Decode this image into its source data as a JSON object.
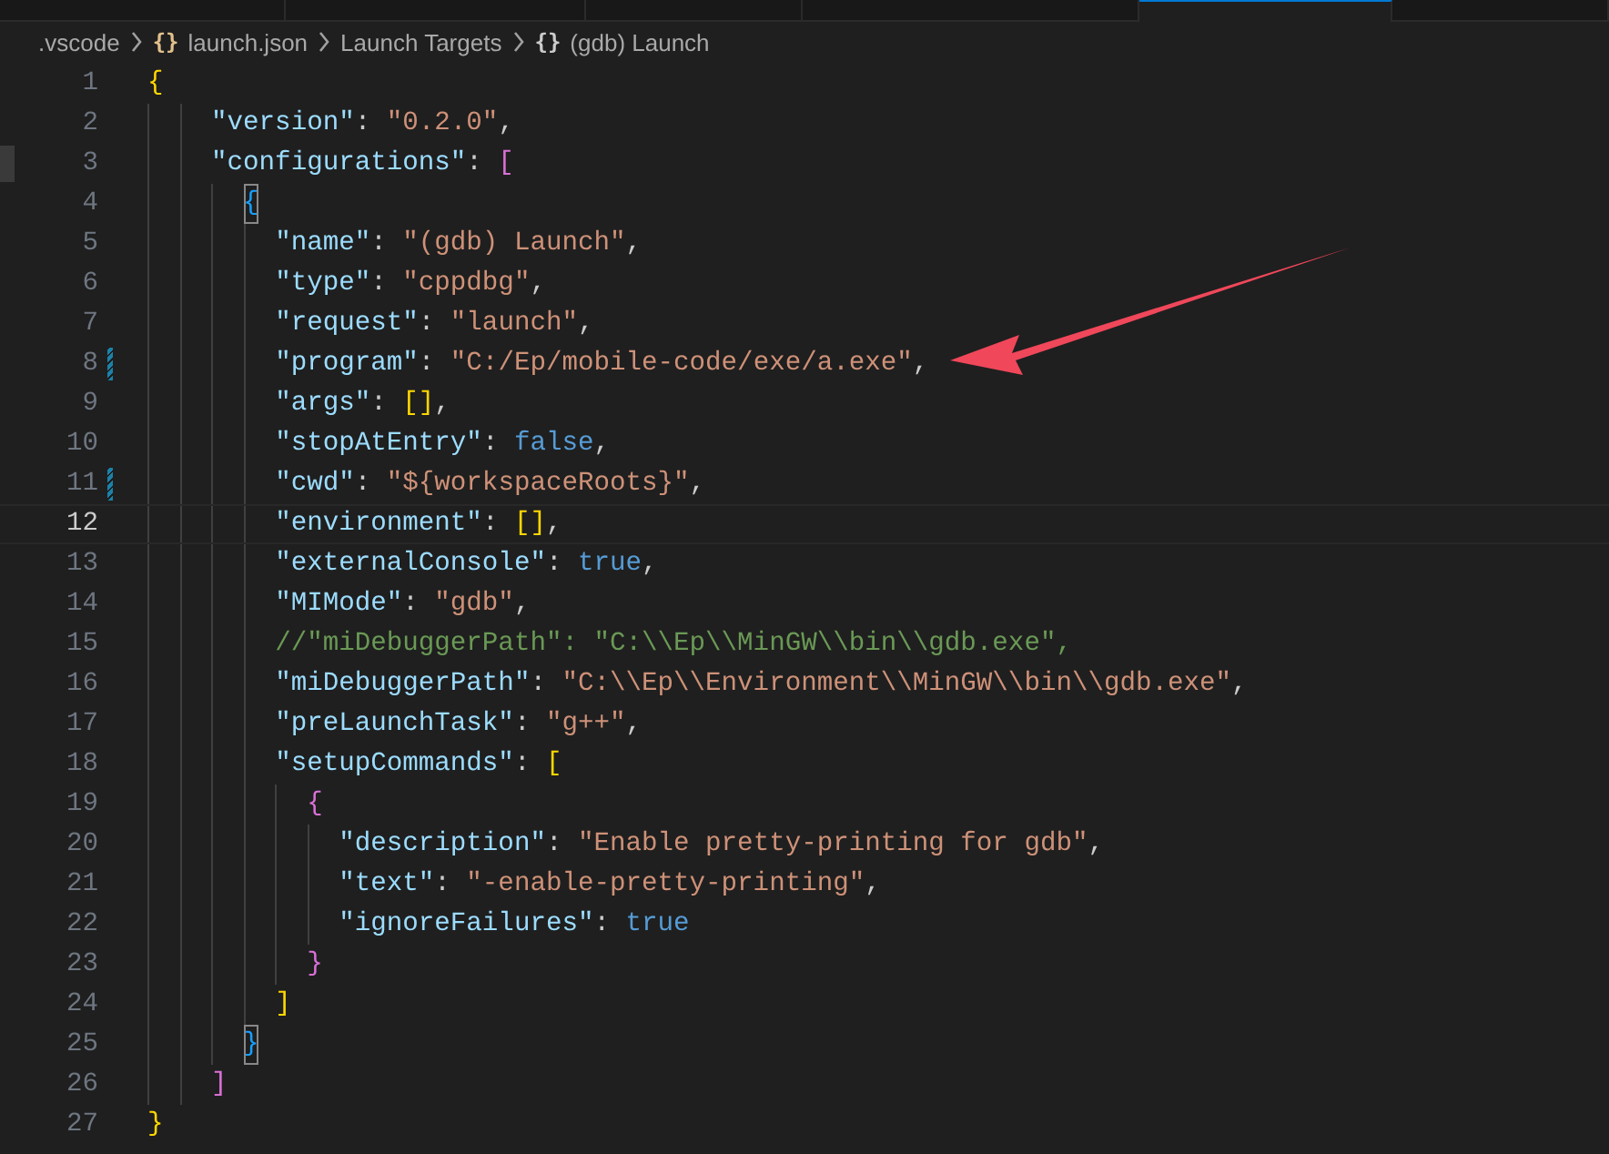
{
  "tabs": [
    {
      "selected": false
    },
    {
      "selected": false
    },
    {
      "selected": false
    },
    {
      "selected": false
    },
    {
      "selected": true
    },
    {
      "selected": false
    }
  ],
  "breadcrumb": [
    {
      "text": ".vscode"
    },
    {
      "icon": "{}",
      "color": "#e2c08d",
      "text": "launch.json"
    },
    {
      "text": "Launch Targets"
    },
    {
      "icon": "{}",
      "color": "#cccccc",
      "text": "(gdb) Launch"
    }
  ],
  "lines": [
    {
      "number": "1",
      "current": false,
      "modified": false,
      "tokens": [
        {
          "kind": "bracket",
          "text": "{",
          "color": "#ffd700",
          "matched": false
        }
      ],
      "children": [
        {
          "number": "2",
          "current": false,
          "modified": false,
          "tokens": [
            {
              "kind": "key",
              "text": "\"version\""
            },
            {
              "kind": "punct",
              "text": ": "
            },
            {
              "kind": "string",
              "text": "\"0.2.0\""
            },
            {
              "kind": "punct",
              "text": ","
            }
          ]
        },
        {
          "number": "3",
          "current": false,
          "modified": false,
          "tokens": [
            {
              "kind": "key",
              "text": "\"configurations\""
            },
            {
              "kind": "punct",
              "text": ": "
            },
            {
              "kind": "bracket",
              "text": "[",
              "color": "#da70d6",
              "matched": false
            }
          ],
          "children": [
            {
              "number": "4",
              "current": false,
              "modified": false,
              "tokens": [
                {
                  "kind": "bracket",
                  "text": "{",
                  "color": "#179fff",
                  "matched": true
                }
              ],
              "children": [
                {
                  "number": "5",
                  "current": false,
                  "modified": false,
                  "tokens": [
                    {
                      "kind": "key",
                      "text": "\"name\""
                    },
                    {
                      "kind": "punct",
                      "text": ": "
                    },
                    {
                      "kind": "string",
                      "text": "\"(gdb) Launch\""
                    },
                    {
                      "kind": "punct",
                      "text": ","
                    }
                  ]
                },
                {
                  "number": "6",
                  "current": false,
                  "modified": false,
                  "tokens": [
                    {
                      "kind": "key",
                      "text": "\"type\""
                    },
                    {
                      "kind": "punct",
                      "text": ": "
                    },
                    {
                      "kind": "string",
                      "text": "\"cppdbg\""
                    },
                    {
                      "kind": "punct",
                      "text": ","
                    }
                  ]
                },
                {
                  "number": "7",
                  "current": false,
                  "modified": false,
                  "tokens": [
                    {
                      "kind": "key",
                      "text": "\"request\""
                    },
                    {
                      "kind": "punct",
                      "text": ": "
                    },
                    {
                      "kind": "string",
                      "text": "\"launch\""
                    },
                    {
                      "kind": "punct",
                      "text": ","
                    }
                  ]
                },
                {
                  "number": "8",
                  "current": false,
                  "modified": true,
                  "tokens": [
                    {
                      "kind": "key",
                      "text": "\"program\""
                    },
                    {
                      "kind": "punct",
                      "text": ": "
                    },
                    {
                      "kind": "string",
                      "text": "\"C:/Ep/mobile-code/exe/a.exe\""
                    },
                    {
                      "kind": "punct",
                      "text": ","
                    }
                  ]
                },
                {
                  "number": "9",
                  "current": false,
                  "modified": false,
                  "tokens": [
                    {
                      "kind": "key",
                      "text": "\"args\""
                    },
                    {
                      "kind": "punct",
                      "text": ": "
                    },
                    {
                      "kind": "bracket",
                      "text": "[]",
                      "color": "#ffd700",
                      "matched": false
                    },
                    {
                      "kind": "punct",
                      "text": ","
                    }
                  ]
                },
                {
                  "number": "10",
                  "current": false,
                  "modified": false,
                  "tokens": [
                    {
                      "kind": "key",
                      "text": "\"stopAtEntry\""
                    },
                    {
                      "kind": "punct",
                      "text": ": "
                    },
                    {
                      "kind": "keyword",
                      "text": "false"
                    },
                    {
                      "kind": "punct",
                      "text": ","
                    }
                  ]
                },
                {
                  "number": "11",
                  "current": false,
                  "modified": true,
                  "tokens": [
                    {
                      "kind": "key",
                      "text": "\"cwd\""
                    },
                    {
                      "kind": "punct",
                      "text": ": "
                    },
                    {
                      "kind": "string",
                      "text": "\"${workspaceRoots}\""
                    },
                    {
                      "kind": "punct",
                      "text": ","
                    }
                  ]
                },
                {
                  "number": "12",
                  "current": true,
                  "modified": false,
                  "tokens": [
                    {
                      "kind": "key",
                      "text": "\"environment\""
                    },
                    {
                      "kind": "punct",
                      "text": ": "
                    },
                    {
                      "kind": "bracket",
                      "text": "[]",
                      "color": "#ffd700",
                      "matched": false
                    },
                    {
                      "kind": "punct",
                      "text": ","
                    }
                  ]
                },
                {
                  "number": "13",
                  "current": false,
                  "modified": false,
                  "tokens": [
                    {
                      "kind": "key",
                      "text": "\"externalConsole\""
                    },
                    {
                      "kind": "punct",
                      "text": ": "
                    },
                    {
                      "kind": "keyword",
                      "text": "true"
                    },
                    {
                      "kind": "punct",
                      "text": ","
                    }
                  ]
                },
                {
                  "number": "14",
                  "current": false,
                  "modified": false,
                  "tokens": [
                    {
                      "kind": "key",
                      "text": "\"MIMode\""
                    },
                    {
                      "kind": "punct",
                      "text": ": "
                    },
                    {
                      "kind": "string",
                      "text": "\"gdb\""
                    },
                    {
                      "kind": "punct",
                      "text": ","
                    }
                  ]
                },
                {
                  "number": "15",
                  "current": false,
                  "modified": false,
                  "tokens": [
                    {
                      "kind": "comment",
                      "text": "//\"miDebuggerPath\": \"C:\\\\Ep\\\\MinGW\\\\bin\\\\gdb.exe\","
                    }
                  ]
                },
                {
                  "number": "16",
                  "current": false,
                  "modified": false,
                  "tokens": [
                    {
                      "kind": "key",
                      "text": "\"miDebuggerPath\""
                    },
                    {
                      "kind": "punct",
                      "text": ": "
                    },
                    {
                      "kind": "string",
                      "text": "\"C:\\\\Ep\\\\Environment\\\\MinGW\\\\bin\\\\gdb.exe\""
                    },
                    {
                      "kind": "punct",
                      "text": ","
                    }
                  ]
                },
                {
                  "number": "17",
                  "current": false,
                  "modified": false,
                  "tokens": [
                    {
                      "kind": "key",
                      "text": "\"preLaunchTask\""
                    },
                    {
                      "kind": "punct",
                      "text": ": "
                    },
                    {
                      "kind": "string",
                      "text": "\"g++\""
                    },
                    {
                      "kind": "punct",
                      "text": ","
                    }
                  ]
                },
                {
                  "number": "18",
                  "current": false,
                  "modified": false,
                  "tokens": [
                    {
                      "kind": "key",
                      "text": "\"setupCommands\""
                    },
                    {
                      "kind": "punct",
                      "text": ": "
                    },
                    {
                      "kind": "bracket",
                      "text": "[",
                      "color": "#ffd700",
                      "matched": false
                    }
                  ],
                  "children": [
                    {
                      "number": "19",
                      "current": false,
                      "modified": false,
                      "tokens": [
                        {
                          "kind": "bracket",
                          "text": "{",
                          "color": "#da70d6",
                          "matched": false
                        }
                      ],
                      "children": [
                        {
                          "number": "20",
                          "current": false,
                          "modified": false,
                          "tokens": [
                            {
                              "kind": "key",
                              "text": "\"description\""
                            },
                            {
                              "kind": "punct",
                              "text": ": "
                            },
                            {
                              "kind": "string",
                              "text": "\"Enable pretty-printing for gdb\""
                            },
                            {
                              "kind": "punct",
                              "text": ","
                            }
                          ]
                        },
                        {
                          "number": "21",
                          "current": false,
                          "modified": false,
                          "tokens": [
                            {
                              "kind": "key",
                              "text": "\"text\""
                            },
                            {
                              "kind": "punct",
                              "text": ": "
                            },
                            {
                              "kind": "string",
                              "text": "\"-enable-pretty-printing\""
                            },
                            {
                              "kind": "punct",
                              "text": ","
                            }
                          ]
                        },
                        {
                          "number": "22",
                          "current": false,
                          "modified": false,
                          "tokens": [
                            {
                              "kind": "key",
                              "text": "\"ignoreFailures\""
                            },
                            {
                              "kind": "punct",
                              "text": ": "
                            },
                            {
                              "kind": "keyword",
                              "text": "true"
                            }
                          ]
                        }
                      ]
                    },
                    {
                      "number": "23",
                      "current": false,
                      "modified": false,
                      "tokens": [
                        {
                          "kind": "bracket",
                          "text": "}",
                          "color": "#da70d6",
                          "matched": false
                        }
                      ]
                    }
                  ]
                },
                {
                  "number": "24",
                  "current": false,
                  "modified": false,
                  "tokens": [
                    {
                      "kind": "bracket",
                      "text": "]",
                      "color": "#ffd700",
                      "matched": false
                    }
                  ]
                }
              ]
            },
            {
              "number": "25",
              "current": false,
              "modified": false,
              "tokens": [
                {
                  "kind": "bracket",
                  "text": "}",
                  "color": "#179fff",
                  "matched": true
                }
              ]
            }
          ]
        },
        {
          "number": "26",
          "current": false,
          "modified": false,
          "tokens": [
            {
              "kind": "bracket",
              "text": "]",
              "color": "#da70d6",
              "matched": false
            }
          ]
        }
      ]
    },
    {
      "number": "27",
      "current": false,
      "modified": false,
      "tokens": [
        {
          "kind": "bracket",
          "text": "}",
          "color": "#ffd700",
          "matched": false
        }
      ]
    }
  ]
}
